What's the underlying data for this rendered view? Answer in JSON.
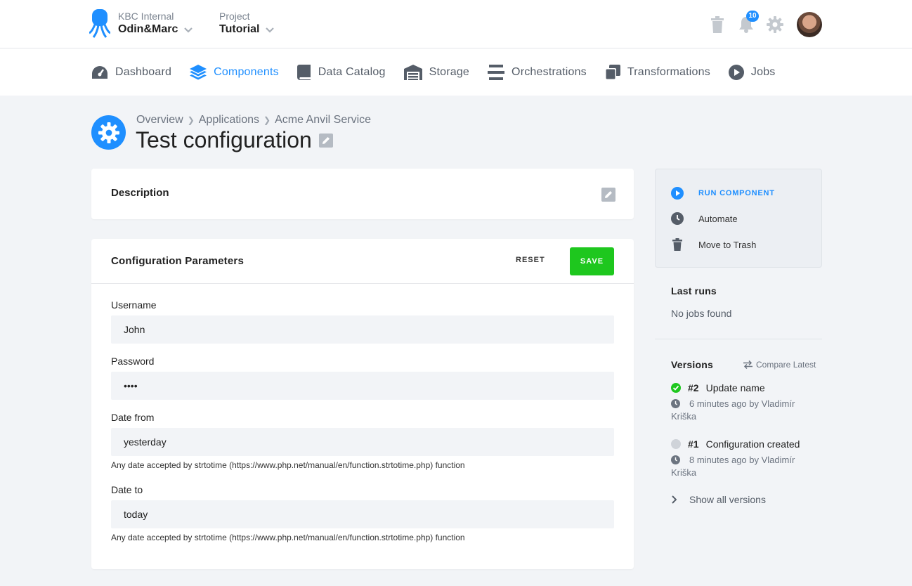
{
  "header": {
    "org_label": "KBC Internal",
    "org_name": "Odin&Marc",
    "project_label": "Project",
    "project_name": "Tutorial",
    "notification_count": "10"
  },
  "nav": {
    "items": [
      {
        "label": "Dashboard",
        "icon": "dashboard-icon"
      },
      {
        "label": "Components",
        "icon": "layers-icon",
        "active": true
      },
      {
        "label": "Data Catalog",
        "icon": "book-icon"
      },
      {
        "label": "Storage",
        "icon": "warehouse-icon"
      },
      {
        "label": "Orchestrations",
        "icon": "bars-icon"
      },
      {
        "label": "Transformations",
        "icon": "copy-icon"
      },
      {
        "label": "Jobs",
        "icon": "play-circle-icon"
      }
    ]
  },
  "page": {
    "breadcrumb": [
      "Overview",
      "Applications",
      "Acme Anvil Service"
    ],
    "title": "Test configuration"
  },
  "description_card": {
    "title": "Description"
  },
  "config": {
    "title": "Configuration Parameters",
    "reset_label": "RESET",
    "save_label": "SAVE",
    "fields": [
      {
        "label": "Username",
        "value": "John"
      },
      {
        "label": "Password",
        "value": "••••"
      },
      {
        "label": "Date from",
        "value": "yesterday",
        "help": "Any date accepted by strtotime (https://www.php.net/manual/en/function.strtotime.php) function"
      },
      {
        "label": "Date to",
        "value": "today",
        "help": "Any date accepted by strtotime (https://www.php.net/manual/en/function.strtotime.php) function"
      }
    ]
  },
  "sidebar": {
    "actions": {
      "run": "RUN COMPONENT",
      "automate": "Automate",
      "trash": "Move to Trash"
    },
    "last_runs": {
      "title": "Last runs",
      "empty": "No jobs found"
    },
    "versions": {
      "title": "Versions",
      "compare_label": "Compare Latest",
      "items": [
        {
          "num": "#2",
          "name": "Update name",
          "meta": "6 minutes ago by Vladimír Kriška",
          "status": "success"
        },
        {
          "num": "#1",
          "name": "Configuration created",
          "meta": "8 minutes ago by Vladimír Kriška",
          "status": "inactive"
        }
      ],
      "show_all": "Show all versions"
    }
  },
  "colors": {
    "accent": "#1f8fff",
    "save": "#1ec71e",
    "success": "#1ec71e"
  }
}
